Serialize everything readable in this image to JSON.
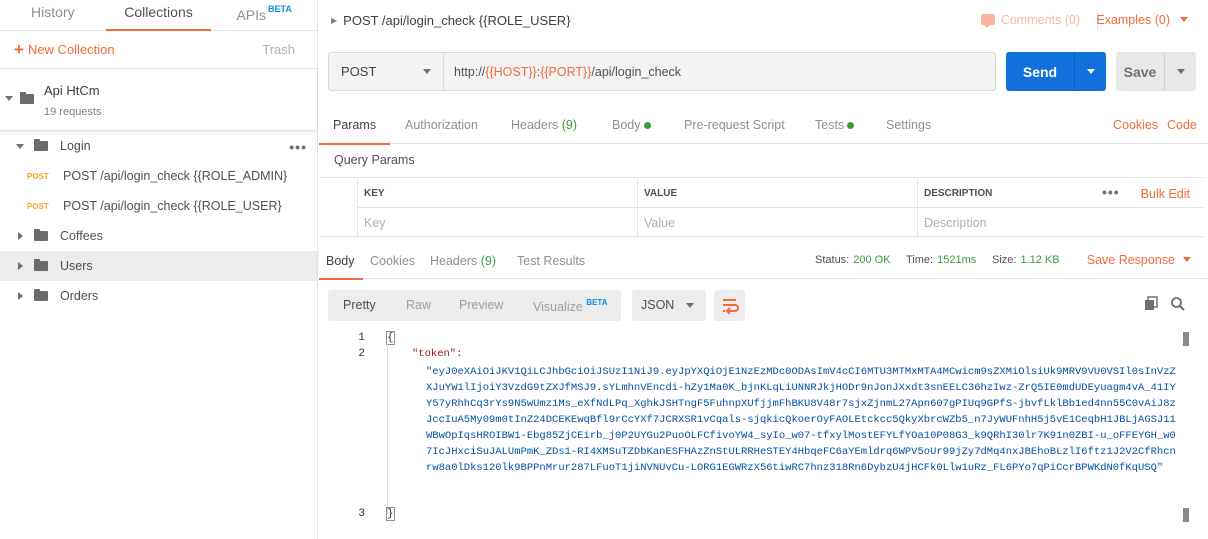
{
  "sidebar": {
    "tabs": [
      {
        "label": "History"
      },
      {
        "label": "Collections"
      },
      {
        "label": "APIs",
        "badge": "BETA"
      }
    ],
    "new_collection": "New Collection",
    "trash": "Trash",
    "collection": {
      "name": "Api HtCm",
      "count": "19 requests"
    },
    "items": [
      {
        "label": "Login"
      },
      {
        "method": "POST",
        "label": "POST /api/login_check {{ROLE_ADMIN}"
      },
      {
        "method": "POST",
        "label": "POST /api/login_check {{ROLE_USER}"
      },
      {
        "label": "Coffees"
      },
      {
        "label": "Users"
      },
      {
        "label": "Orders"
      }
    ]
  },
  "request": {
    "title": "POST /api/login_check {{ROLE_USER}",
    "comments": "Comments (0)",
    "examples": "Examples (0)",
    "method": "POST",
    "url": {
      "prefix": "http://",
      "host": "{{HOST}}",
      "colon": ":",
      "port": "{{PORT}}",
      "path": "/api/login_check"
    },
    "send": "Send",
    "save": "Save",
    "tabs": {
      "params": "Params",
      "authorization": "Authorization",
      "headers": "Headers",
      "headers_count": "(9)",
      "body": "Body",
      "prerequest": "Pre-request Script",
      "tests": "Tests",
      "settings": "Settings",
      "cookies": "Cookies",
      "code": "Code"
    },
    "query_params": {
      "title": "Query Params",
      "headers": [
        "KEY",
        "VALUE",
        "DESCRIPTION"
      ],
      "placeholders": [
        "Key",
        "Value",
        "Description"
      ],
      "bulk_edit": "Bulk Edit"
    }
  },
  "response": {
    "tabs": {
      "body": "Body",
      "cookies": "Cookies",
      "headers": "Headers",
      "headers_count": "(9)",
      "test_results": "Test Results"
    },
    "status_label": "Status:",
    "status": "200 OK",
    "time_label": "Time:",
    "time": "1521ms",
    "size_label": "Size:",
    "size": "1.12 KB",
    "save_response": "Save Response",
    "views": {
      "pretty": "Pretty",
      "raw": "Raw",
      "preview": "Preview",
      "visualize": "Visualize",
      "visualize_badge": "BETA"
    },
    "format": "JSON",
    "line_numbers": [
      "1",
      "2",
      "3"
    ],
    "open_brace": "{",
    "close_brace": "}",
    "key": "\"token\":",
    "token": "\"eyJ0eXAiOiJKV1QiLCJhbGciOiJSUzI1NiJ9.eyJpYXQiOjE1NzEzMDc0ODAsImV4cCI6MTU3MTMxMTA4MCwicm9sZXMiOlsiUk9MRV9VU0VSIl0sInVzZXJuYW1lIjoiY3VzdG9tZXJfMSJ9.sYLmhnVEncdi-hZy1Ma0K_bjnKLqLiUNNRJkjHODr9nJonJXxdt3snEELC36hzIwz-ZrQ5IE0mdUDEyuagm4vA_41IYY57yRhhCq3rYs9N5wUmz1Ms_eXfNdLPq_XghkJSHTngF5FuhnpXUfjjmFhBKU8V48r7sjxZjnmL27Apn607gPIUq9GPfS-jbvfLklBb1ed4nn55C0vAiJ8zJccIuA5My09m0tInZ24DCEKEwqBfl9rCcYXf7JCRXSR1vCqals-sjqkicQkoerOyFAOLEtckcc5QkyXbrcWZb5_n7JyWUFnhH5j5vE1CeqbH1JBLjAGSJ11WBwOpIqsHROIBW1-Ebg85ZjCEirb_j0P2UYGu2PuoOLFCfivoYW4_syIo_w07-tfxylMostEFYLfYOa10P08G3_k9QRhI30lr7K91n0ZBI-u_oFFEYGH_w07IcJHxciSuJALUmPmK_ZDs1-RI4XMSuTZDbKanESFHAzZnStULRRHeSTEY4HbqeFC6aYEmldrq6WPV5oUr99jZy7dMq4nxJBEhoBLzlI6ftz1J2V2CfRhcnrw8a0lDks120lk9BPPnMrur287LFuoT1jiNVNUvCu-LORG1EGWRzX56tiwRC7hnz318Rn6DybzU4jHCFk0Llw1uRz_FL6PYo7qPiCcrBPWKdN0fKqUSQ\""
  },
  "colors": {
    "accent": "#f26b3a",
    "send": "#1170dc",
    "success": "#3c9a3c",
    "post": "#f2a626"
  }
}
